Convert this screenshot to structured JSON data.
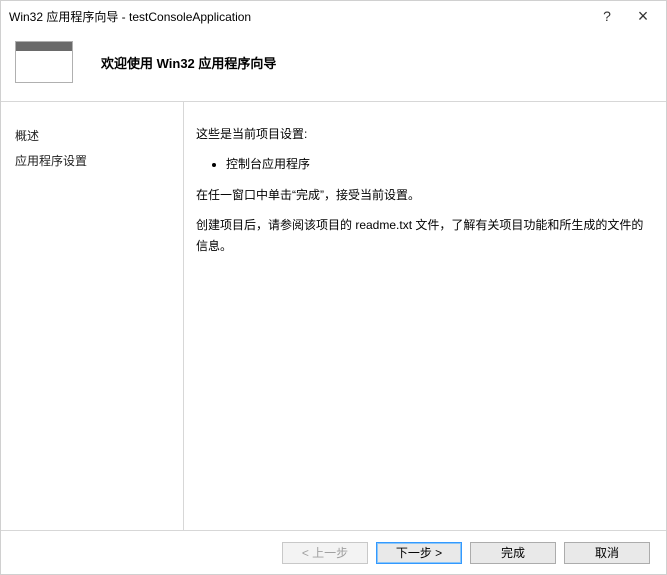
{
  "titlebar": {
    "title": "Win32 应用程序向导 - testConsoleApplication",
    "help_symbol": "?",
    "close_symbol": "×"
  },
  "banner": {
    "heading": "欢迎使用 Win32 应用程序向导"
  },
  "sidebar": {
    "items": [
      {
        "label": "概述"
      },
      {
        "label": "应用程序设置"
      }
    ]
  },
  "main": {
    "intro_line": "这些是当前项目设置:",
    "bullets": [
      "控制台应用程序"
    ],
    "para2": "在任一窗口中单击“完成”，接受当前设置。",
    "para3": "创建项目后，请参阅该项目的 readme.txt 文件，了解有关项目功能和所生成的文件的信息。"
  },
  "buttons": {
    "prev": "< 上一步",
    "next": "下一步 >",
    "finish": "完成",
    "cancel": "取消"
  }
}
